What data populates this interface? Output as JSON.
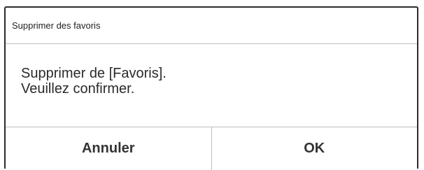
{
  "dialog": {
    "title": "Supprimer des favoris",
    "message_line1": "Supprimer de [Favoris].",
    "message_line2": "Veuillez confirmer.",
    "cancel_label": "Annuler",
    "ok_label": "OK"
  }
}
